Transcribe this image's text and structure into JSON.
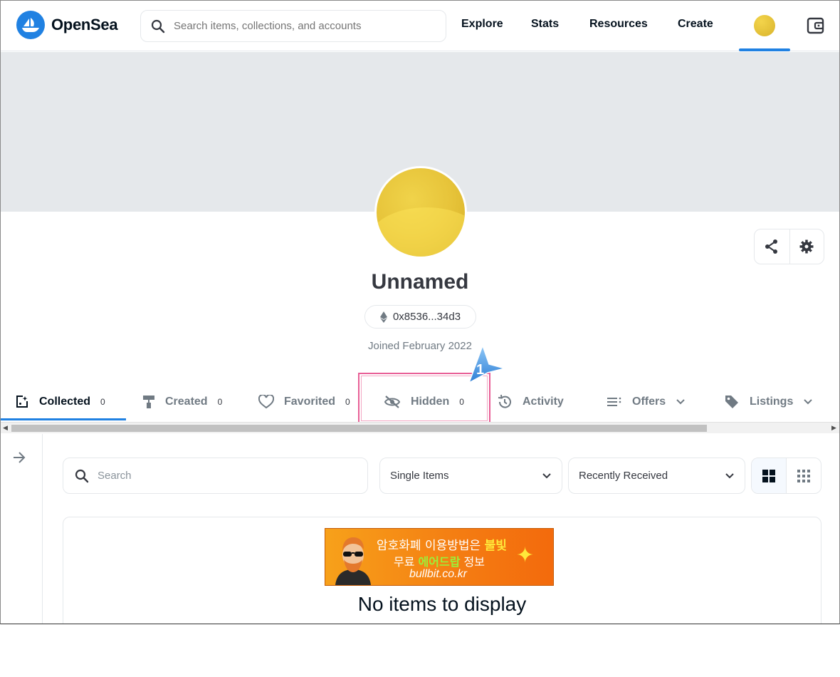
{
  "header": {
    "brand": "OpenSea",
    "search_placeholder": "Search items, collections, and accounts",
    "nav": [
      "Explore",
      "Stats",
      "Resources",
      "Create"
    ]
  },
  "profile": {
    "name": "Unnamed",
    "address": "0x8536...34d3",
    "joined": "Joined February 2022"
  },
  "tabs": [
    {
      "label": "Collected",
      "count": "0"
    },
    {
      "label": "Created",
      "count": "0"
    },
    {
      "label": "Favorited",
      "count": "0"
    },
    {
      "label": "Hidden",
      "count": "0"
    },
    {
      "label": "Activity"
    },
    {
      "label": "Offers"
    },
    {
      "label": "Listings"
    }
  ],
  "filters": {
    "search_placeholder": "Search",
    "item_type": "Single Items",
    "sort": "Recently Received"
  },
  "ad": {
    "line1_prefix": "암호화폐 이용방법은 ",
    "line1_highlight": "불빛",
    "line2_prefix": "무료 ",
    "line2_highlight": "에어드랍",
    "line2_suffix": " 정보",
    "line3": "bullbit.co.kr"
  },
  "empty_state": "No items to display",
  "annotation": {
    "step": "1"
  },
  "colors": {
    "accent": "#2081e2",
    "highlight": "#e85f96"
  }
}
